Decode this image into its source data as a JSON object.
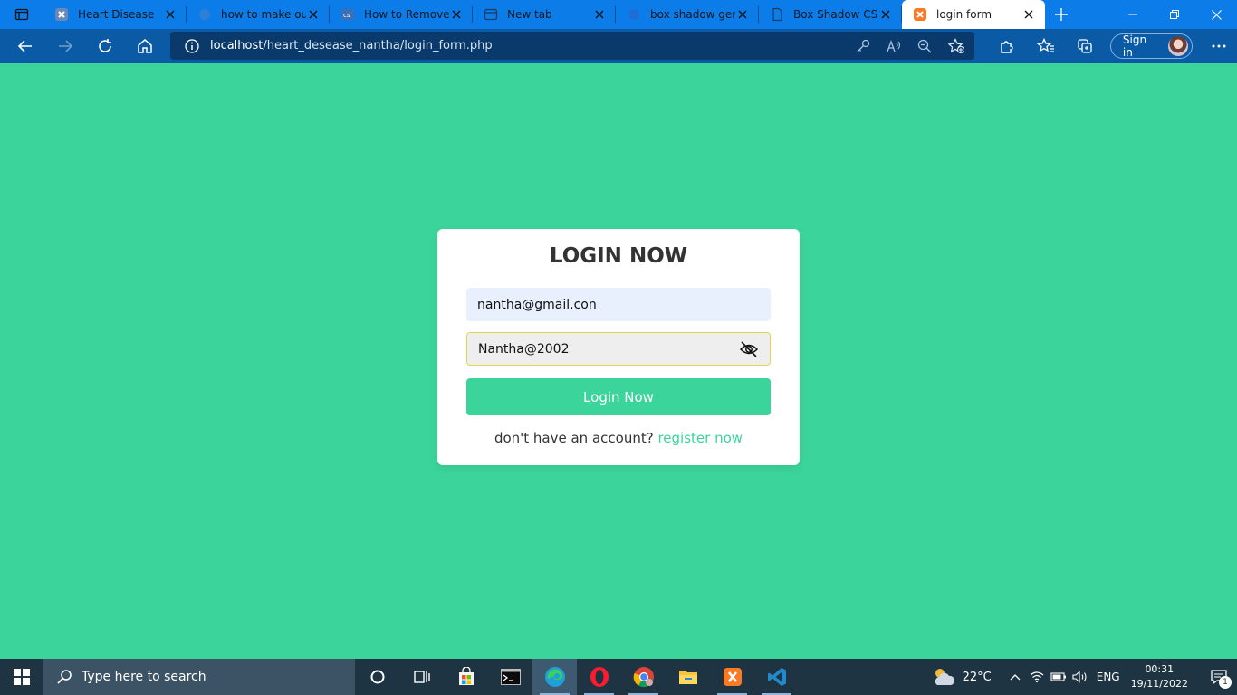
{
  "browser": {
    "tabs": [
      {
        "title": "Heart Disease",
        "icon": "xampp-icon"
      },
      {
        "title": "how to make outl",
        "icon": "page-icon"
      },
      {
        "title": "How to Remove",
        "icon": "code-icon"
      },
      {
        "title": "New tab",
        "icon": "newtab-icon"
      },
      {
        "title": "box shadow gene",
        "icon": "globe-icon"
      },
      {
        "title": "Box Shadow CSS",
        "icon": "document-icon"
      },
      {
        "title": "login form",
        "icon": "xampp-icon",
        "active": true
      }
    ],
    "address": {
      "host": "localhost",
      "path": "/heart_desease_nantha/login_form.php"
    },
    "sign_in_label": "Sign in"
  },
  "login": {
    "title": "LOGIN NOW",
    "email_value": "nantha@gmail.con",
    "password_value": "Nantha@2002",
    "button_label": "Login Now",
    "register_prompt": "don't have an account?",
    "register_link": "register now"
  },
  "taskbar": {
    "search_placeholder": "Type here to search",
    "temperature": "22°C",
    "language": "ENG",
    "time": "00:31",
    "date": "19/11/2022",
    "notification_count": "1"
  },
  "colors": {
    "page_background": "#3bd59c",
    "accent": "#3bd59c",
    "tabstrip": "#0c7ce8",
    "toolbar": "#0b5aa6",
    "taskbar": "#1e3442"
  }
}
